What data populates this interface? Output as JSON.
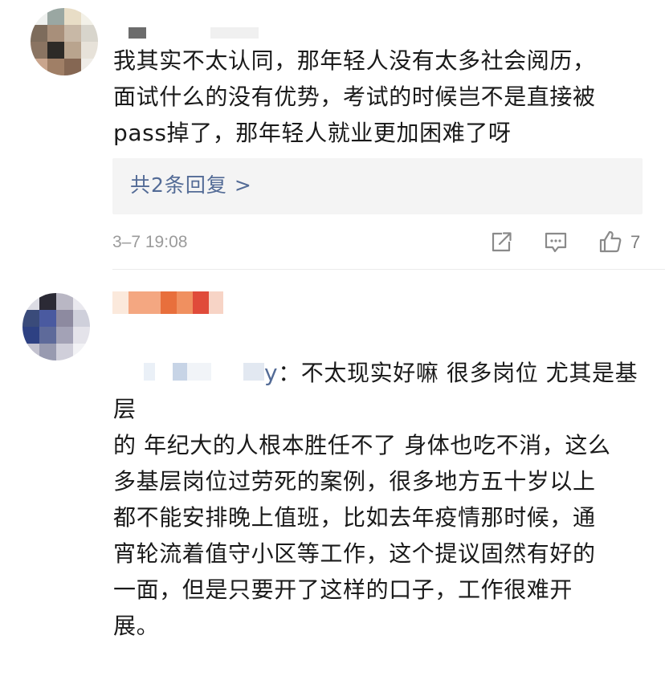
{
  "comments": [
    {
      "text": "我其实不太认同，那年轻人没有太多社会阅历，\n面试什么的没有优势，考试的时候岂不是直接被\npass掉了，那年轻人就业更加困难了呀",
      "replies_label": "共2条回复 >",
      "time": "3–7 19:08",
      "like_count": "7",
      "icons": [
        "share-icon",
        "comment-icon",
        "like-icon"
      ]
    },
    {
      "mention_suffix": "y",
      "text": "：不太现实好嘛 很多岗位 尤其是基层\n的 年纪大的人根本胜任不了 身体也吃不消，这么\n多基层岗位过劳死的案例，很多地方五十岁以上\n都不能安排晚上值班，比如去年疫情那时候，通\n宵轮流着值守小区等工作，这个提议固然有好的\n一面，但是只要开了这样的口子，工作很难开\n展。"
    }
  ],
  "colors": {
    "link": "#536b96",
    "meta": "#9b9b9b",
    "reply_box_bg": "#f4f4f4",
    "icon": "#8a8a8a"
  }
}
